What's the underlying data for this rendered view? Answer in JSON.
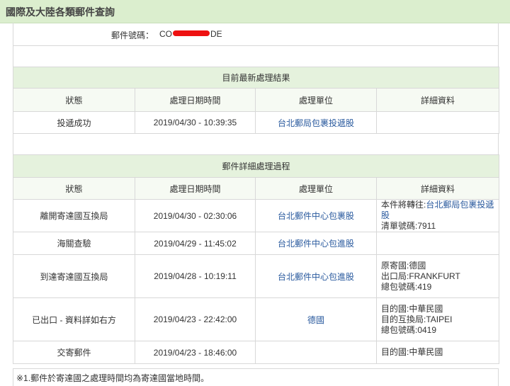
{
  "page": {
    "title": "國際及大陸各類郵件查詢"
  },
  "tracking": {
    "label": "郵件號碼：",
    "prefix": "CO",
    "suffix": "DE"
  },
  "latest": {
    "caption": "目前最新處理結果",
    "headers": [
      "狀態",
      "處理日期時間",
      "處理單位",
      "詳細資料"
    ],
    "row": {
      "status": "投遞成功",
      "datetime": "2019/04/30 - 10:39:35",
      "unit": "台北郵局包裹投遞股",
      "detail": ""
    }
  },
  "history": {
    "caption": "郵件詳細處理過程",
    "headers": [
      "狀態",
      "處理日期時間",
      "處理單位",
      "詳細資料"
    ],
    "rows": [
      {
        "status": "離開寄達國互換局",
        "datetime": "2019/04/30 - 02:30:06",
        "unit": "台北郵件中心包裹股",
        "detail": [
          "本件將轉往:台北郵局包裹投遞股",
          "清單號碼:7911"
        ]
      },
      {
        "status": "海關查驗",
        "datetime": "2019/04/29 - 11:45:02",
        "unit": "台北郵件中心包進股",
        "detail": []
      },
      {
        "status": "到達寄達國互換局",
        "datetime": "2019/04/28 - 10:19:11",
        "unit": "台北郵件中心包進股",
        "detail": [
          "原寄國:德國",
          "出口局:FRANKFURT",
          "總包號碼:419"
        ]
      },
      {
        "status": "已出口 - 資料詳如右方",
        "datetime": "2019/04/23 - 22:42:00",
        "unit": "德國",
        "detail": [
          "目的國:中華民國",
          "目的互換局:TAIPEI",
          "總包號碼:0419"
        ]
      },
      {
        "status": "交寄郵件",
        "datetime": "2019/04/23 - 18:46:00",
        "unit": "",
        "detail": [
          "目的國:中華民國"
        ]
      }
    ]
  },
  "note": "※1.郵件於寄達國之處理時間均為寄達國當地時間。",
  "colors": {
    "header_bg": "#dbeece",
    "caption_bg": "#e5f2dd",
    "link": "#2a5a9e",
    "redaction": "#ee1111"
  }
}
